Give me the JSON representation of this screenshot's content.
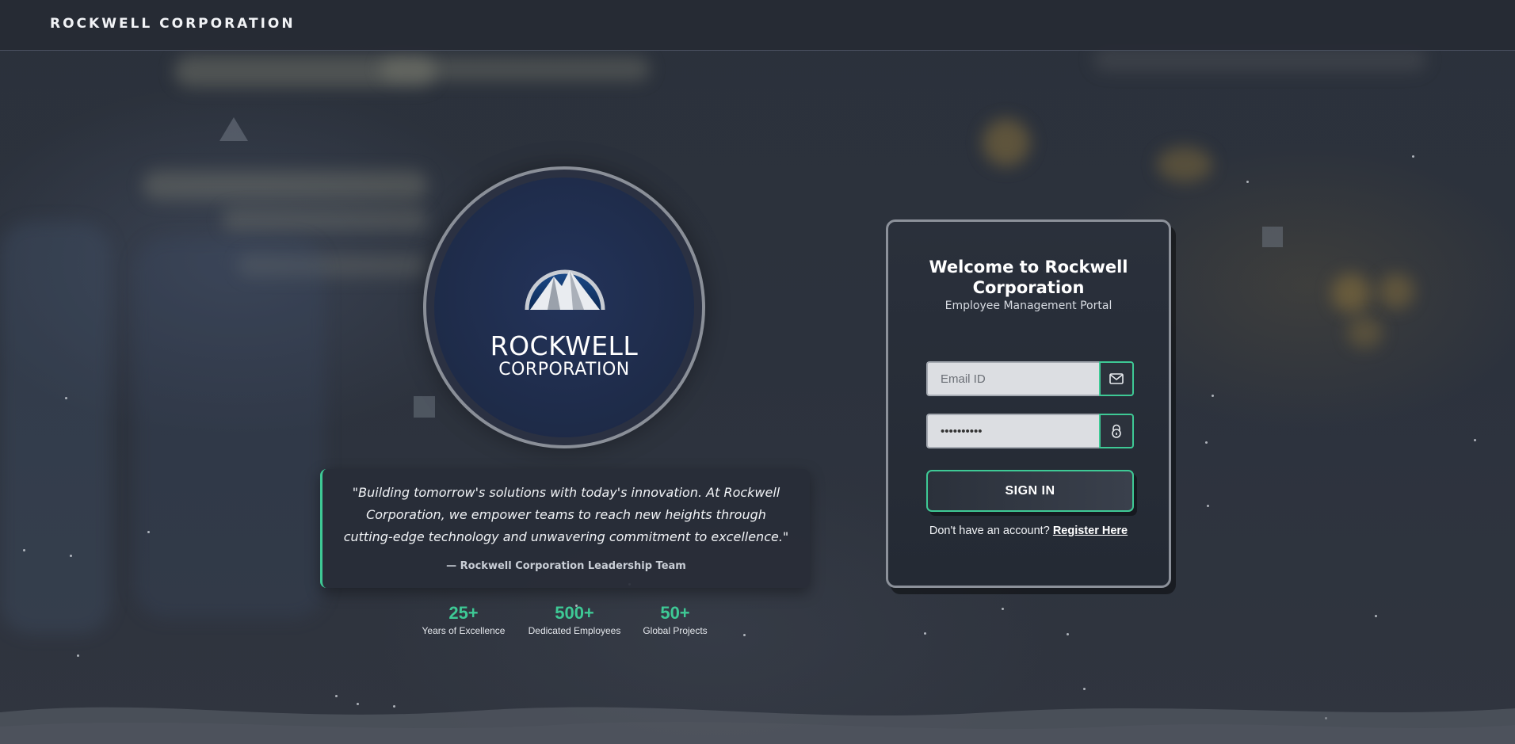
{
  "header": {
    "brand": "ROCKWELL CORPORATION"
  },
  "logo": {
    "line1": "ROCKWELL",
    "line2": "CORPORATION"
  },
  "quote": {
    "text": "\"Building tomorrow's solutions with today's innovation. At Rockwell Corporation, we empower teams to reach new heights through cutting-edge technology and unwavering commitment to excellence.\"",
    "author": "— Rockwell Corporation Leadership Team"
  },
  "stats": [
    {
      "value": "25+",
      "label": "Years of Excellence"
    },
    {
      "value": "500+",
      "label": "Dedicated Employees"
    },
    {
      "value": "50+",
      "label": "Global Projects"
    }
  ],
  "login": {
    "title": "Welcome to Rockwell Corporation",
    "subtitle": "Employee Management Portal",
    "email_placeholder": "Email ID",
    "password_value": "**********",
    "signin_label": "SIGN IN",
    "register_prompt": "Don't have an account?",
    "register_link": "Register Here"
  },
  "colors": {
    "accent": "#3ec995",
    "header_bg": "#262b34",
    "card_border": "#8c919a"
  }
}
